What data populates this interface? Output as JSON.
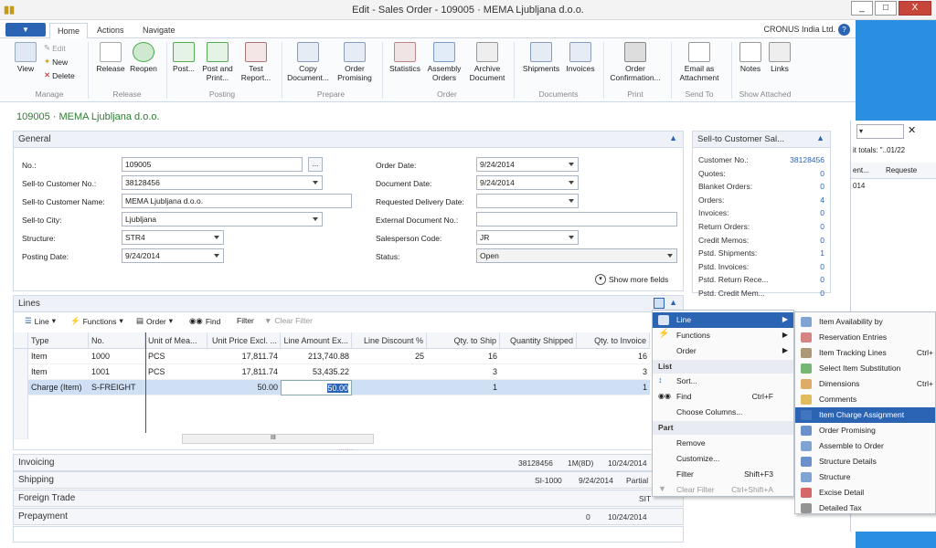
{
  "window": {
    "title": "Edit - Sales Order - 109005 · MEMA Ljubljana d.o.o.",
    "min": "_",
    "max": "□",
    "close": "X"
  },
  "ribbon_tabs": {
    "menu": "▼",
    "home": "Home",
    "actions": "Actions",
    "navigate": "Navigate"
  },
  "company": "CRONUS India Ltd.",
  "help": "?",
  "ribbon": {
    "view": "View",
    "edit": "Edit",
    "new": "New",
    "delete": "Delete",
    "manage": "Manage",
    "release": "Release",
    "reopen": "Reopen",
    "release_group": "Release",
    "post": "Post...",
    "post_print": "Post and Print...",
    "test_report": "Test Report...",
    "posting_group": "Posting",
    "copy_document": "Copy Document...",
    "order_promising": "Order Promising",
    "prepare_group": "Prepare",
    "statistics": "Statistics",
    "assembly_orders": "Assembly Orders",
    "archive_document": "Archive Document",
    "order_group": "Order",
    "shipments": "Shipments",
    "invoices": "Invoices",
    "documents_group": "Documents",
    "order_confirmation": "Order Confirmation...",
    "print_group": "Print",
    "email_attachment": "Email as Attachment",
    "sendto_group": "Send To",
    "notes": "Notes",
    "links": "Links",
    "showattached_group": "Show Attached"
  },
  "page_title": "109005 · MEMA Ljubljana d.o.o.",
  "general": {
    "header": "General",
    "no_label": "No.:",
    "no": "109005",
    "dots": "...",
    "sell_no_label": "Sell-to Customer No.:",
    "sell_no": "38128456",
    "sell_name_label": "Sell-to Customer Name:",
    "sell_name": "MEMA Ljubljana d.o.o.",
    "city_label": "Sell-to City:",
    "city": "Ljubljana",
    "structure_label": "Structure:",
    "structure": "STR4",
    "posting_date_label": "Posting Date:",
    "posting_date": "9/24/2014",
    "order_date_label": "Order Date:",
    "order_date": "9/24/2014",
    "doc_date_label": "Document Date:",
    "doc_date": "9/24/2014",
    "req_del_label": "Requested Delivery Date:",
    "req_del": "",
    "ext_doc_label": "External Document No.:",
    "ext_doc": "",
    "sales_code_label": "Salesperson Code:",
    "sales_code": "JR",
    "status_label": "Status:",
    "status": "Open",
    "show_more": "Show more fields"
  },
  "factbox": {
    "header": "Sell-to Customer Sal...",
    "rows": [
      {
        "label": "Customer No.:",
        "value": "38128456"
      },
      {
        "label": "Quotes:",
        "value": "0"
      },
      {
        "label": "Blanket Orders:",
        "value": "0"
      },
      {
        "label": "Orders:",
        "value": "4"
      },
      {
        "label": "Invoices:",
        "value": "0"
      },
      {
        "label": "Return Orders:",
        "value": "0"
      },
      {
        "label": "Credit Memos:",
        "value": "0"
      },
      {
        "label": "Pstd. Shipments:",
        "value": "1"
      },
      {
        "label": "Pstd. Invoices:",
        "value": "0"
      },
      {
        "label": "Pstd. Return Rece...",
        "value": "0"
      },
      {
        "label": "Pstd. Credit Mem...",
        "value": "0"
      }
    ]
  },
  "lines": {
    "header": "Lines",
    "tool_line": "Line",
    "tool_functions": "Functions",
    "tool_order": "Order",
    "tool_find": "Find",
    "tool_filter": "Filter",
    "tool_clear": "Clear Filter",
    "columns": [
      "Type",
      "No.",
      "Unit of Mea...",
      "Unit Price Excl. ...",
      "Line Amount Ex...",
      "Line Discount %",
      "Qty. to Ship",
      "Quantity Shipped",
      "Qty. to Invoice"
    ],
    "rows": [
      [
        "Item",
        "1000",
        "PCS",
        "17,811.74",
        "213,740.88",
        "25",
        "16",
        "",
        "16"
      ],
      [
        "Item",
        "1001",
        "PCS",
        "17,811.74",
        "53,435.22",
        "",
        "3",
        "",
        "3"
      ],
      [
        "Charge (Item)",
        "S-FREIGHT",
        "",
        "50.00",
        "50.00",
        "",
        "1",
        "",
        "1"
      ]
    ],
    "scroll_mark": "III"
  },
  "fasttabs": {
    "invoicing": "Invoicing",
    "invoicing_s1": "38128456",
    "invoicing_s2": "1M(8D)",
    "invoicing_s3": "10/24/2014",
    "shipping": "Shipping",
    "shipping_s1": "SI-1000",
    "shipping_s2": "9/24/2014",
    "shipping_s3": "Partial",
    "foreign": "Foreign Trade",
    "foreign_s1": "SIT",
    "prepayment": "Prepayment",
    "prepayment_s1": "0",
    "prepayment_s2": "10/24/2014"
  },
  "menu1": {
    "line": "Line",
    "functions": "Functions",
    "order": "Order",
    "list_section": "List",
    "sort": "Sort...",
    "find": "Find",
    "find_sc": "Ctrl+F",
    "choose_columns": "Choose Columns...",
    "part_section": "Part",
    "remove": "Remove",
    "customize": "Customize...",
    "filter": "Filter",
    "filter_sc": "Shift+F3",
    "clear_filter": "Clear Filter",
    "clear_filter_sc": "Ctrl+Shift+A"
  },
  "menu2": {
    "items": [
      "Item Availability by",
      "Reservation Entries",
      "Item Tracking Lines",
      "Select Item Substitution",
      "Dimensions",
      "Comments",
      "Item Charge Assignment",
      "Order Promising",
      "Assemble to Order",
      "Structure Details",
      "Structure",
      "Excise Detail",
      "Detailed Tax"
    ],
    "sc_tracking": "Ctrl+",
    "sc_dimensions": "Ctrl+"
  },
  "bgwindow": {
    "totals": "it totals: \"..01/22",
    "col1": "ent...",
    "col2": "Requeste",
    "cell": "014"
  },
  "colors": {
    "accent": "#2c64b4",
    "title_green": "#2e7d32",
    "highlight": "#2c64b4"
  }
}
